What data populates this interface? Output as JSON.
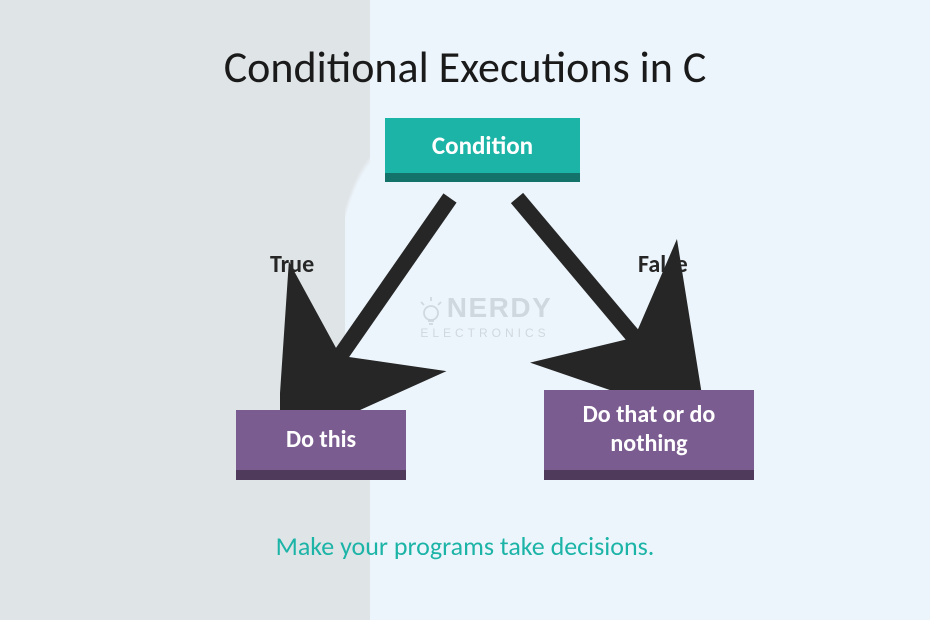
{
  "title": "Conditional Executions in C",
  "nodes": {
    "condition": "Condition",
    "do_this": "Do this",
    "do_that": "Do that or do nothing"
  },
  "edges": {
    "true_label": "True",
    "false_label": "False"
  },
  "watermark": {
    "brand": "NERDY",
    "sub": "ELECTRONICS"
  },
  "tagline": "Make your programs take decisions.",
  "colors": {
    "teal": "#1cb4a7",
    "teal_dark": "#137269",
    "purple": "#7b5c90",
    "purple_dark": "#4f3a5c",
    "arrow": "#262626"
  }
}
